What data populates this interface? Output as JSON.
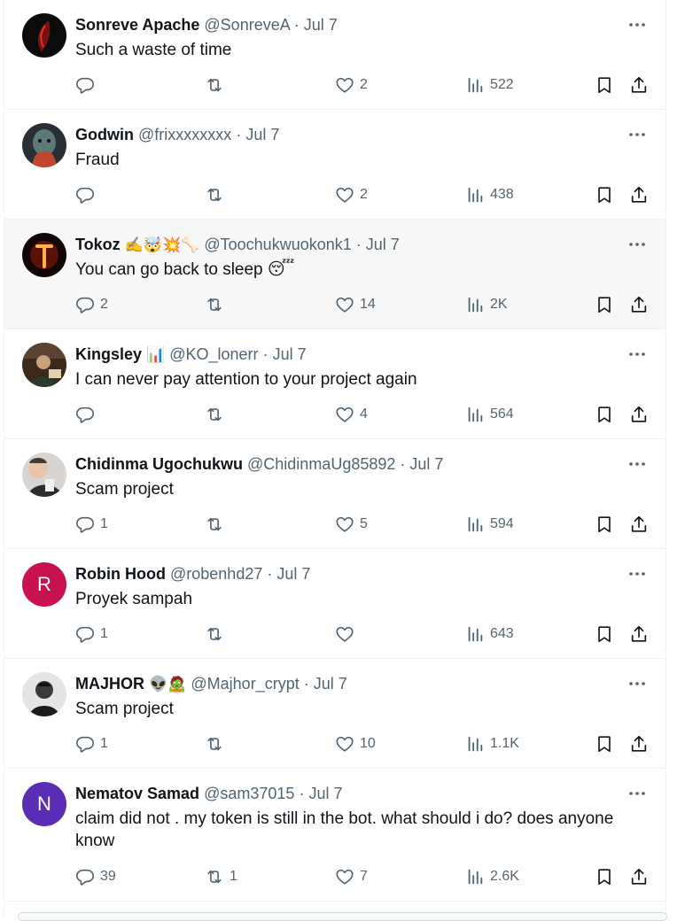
{
  "colors": {
    "text": "#0f1419",
    "muted": "#536471",
    "divider": "#eff3f4",
    "highlight_bg": "#f7f7f7",
    "avatar_r": "#c8124e",
    "avatar_n": "#5b2db5"
  },
  "tweets": [
    {
      "name": "Sonreve Apache",
      "emoji": "",
      "handle": "@SonreveA",
      "dot": "·",
      "date": "Jul 7",
      "text": "Such a waste of time",
      "replies": "",
      "retweets": "",
      "likes": "2",
      "views": "522"
    },
    {
      "name": "Godwin",
      "emoji": "",
      "handle": "@frixxxxxxxx",
      "dot": "·",
      "date": "Jul 7",
      "text": "Fraud",
      "replies": "",
      "retweets": "",
      "likes": "2",
      "views": "438"
    },
    {
      "name": "Tokoz",
      "emoji": "✍️🤯💥🦴",
      "handle": "@Toochukwuokonk1",
      "dot": "·",
      "date": "Jul 7",
      "text": "You can go back to sleep 😴",
      "replies": "2",
      "retweets": "",
      "likes": "14",
      "views": "2K"
    },
    {
      "name": "Kingsley",
      "emoji": "📊",
      "handle": "@KO_lonerr",
      "dot": "·",
      "date": "Jul 7",
      "text": "I can never pay attention to your project again",
      "replies": "",
      "retweets": "",
      "likes": "4",
      "views": "564"
    },
    {
      "name": "Chidinma Ugochukwu",
      "emoji": "",
      "handle": "@ChidinmaUg85892",
      "dot": "·",
      "date": "Jul 7",
      "text": "Scam project",
      "replies": "1",
      "retweets": "",
      "likes": "5",
      "views": "594"
    },
    {
      "name": "Robin Hood",
      "emoji": "",
      "handle": "@robenhd27",
      "dot": "·",
      "date": "Jul 7",
      "text": "Proyek sampah",
      "replies": "1",
      "retweets": "",
      "likes": "",
      "views": "643",
      "avatar_letter": "R"
    },
    {
      "name": "MAJHOR",
      "emoji": "👽🧟",
      "handle": "@Majhor_crypt",
      "dot": "·",
      "date": "Jul 7",
      "text": "Scam project",
      "replies": "1",
      "retweets": "",
      "likes": "10",
      "views": "1.1K"
    },
    {
      "name": "Nematov Samad",
      "emoji": "",
      "handle": "@sam37015",
      "dot": "·",
      "date": "Jul 7",
      "text": "claim did not .  my token is still in the bot.  what should i do?  does anyone know",
      "replies": "39",
      "retweets": "1",
      "likes": "7",
      "views": "2.6K",
      "avatar_letter": "N"
    }
  ]
}
